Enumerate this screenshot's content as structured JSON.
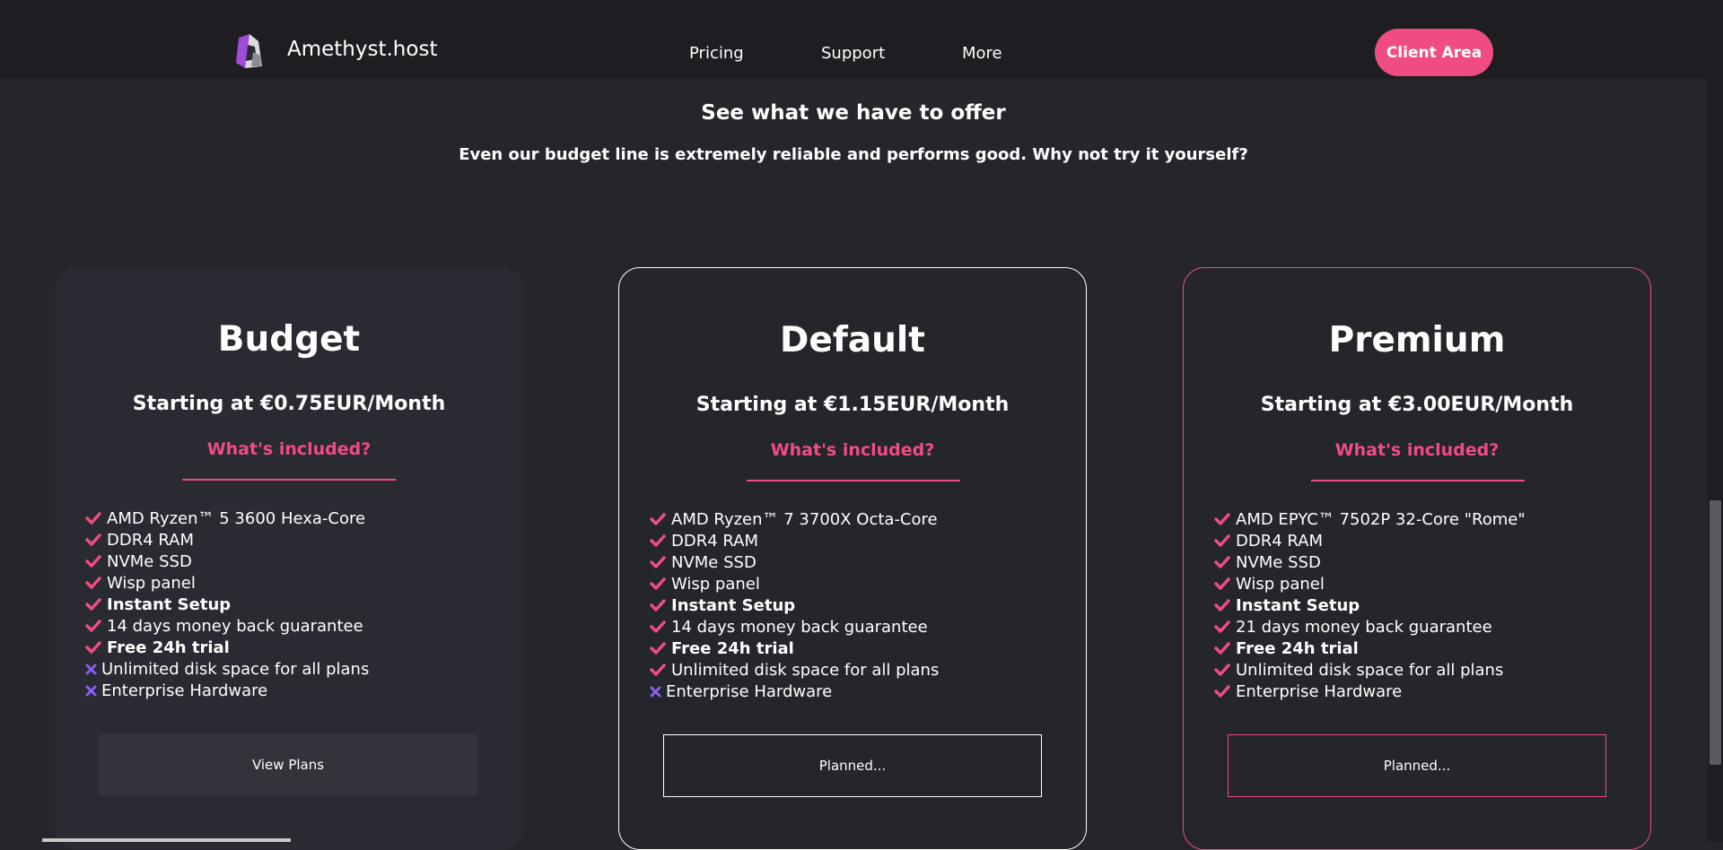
{
  "header": {
    "brand": "Amethyst.host",
    "nav": [
      "Pricing",
      "Support",
      "More"
    ],
    "client_area": "Client Area"
  },
  "section": {
    "title": "See what we have to offer",
    "subtitle": "Even our budget line is extremely reliable and performs good. Why not try it yourself?"
  },
  "colors": {
    "accent": "#ef4d81",
    "check": "#ef4d81",
    "cross": "#8b5cf6",
    "background": "#25252c",
    "navbar": "#1d1d22"
  },
  "plans": [
    {
      "title": "Budget",
      "price": "Starting at €0.75EUR/Month",
      "included_label": "What's included?",
      "button": "View Plans",
      "features": [
        {
          "text": "AMD Ryzen™ 5 3600 Hexa-Core",
          "included": true,
          "bold": false
        },
        {
          "text": "DDR4 RAM",
          "included": true,
          "bold": false
        },
        {
          "text": "NVMe SSD",
          "included": true,
          "bold": false
        },
        {
          "text": "Wisp panel",
          "included": true,
          "bold": false
        },
        {
          "text": "Instant Setup",
          "included": true,
          "bold": true
        },
        {
          "text": "14 days money back guarantee",
          "included": true,
          "bold": false
        },
        {
          "text": "Free 24h trial",
          "included": true,
          "bold": true
        },
        {
          "text": "Unlimited disk space for all plans",
          "included": false,
          "bold": false
        },
        {
          "text": "Enterprise Hardware",
          "included": false,
          "bold": false
        }
      ]
    },
    {
      "title": "Default",
      "price": "Starting at €1.15EUR/Month",
      "included_label": "What's included?",
      "button": "Planned...",
      "features": [
        {
          "text": "AMD Ryzen™ 7 3700X Octa-Core",
          "included": true,
          "bold": false
        },
        {
          "text": "DDR4 RAM",
          "included": true,
          "bold": false
        },
        {
          "text": "NVMe SSD",
          "included": true,
          "bold": false
        },
        {
          "text": "Wisp panel",
          "included": true,
          "bold": false
        },
        {
          "text": "Instant Setup",
          "included": true,
          "bold": true
        },
        {
          "text": "14 days money back guarantee",
          "included": true,
          "bold": false
        },
        {
          "text": "Free 24h trial",
          "included": true,
          "bold": true
        },
        {
          "text": "Unlimited disk space for all plans",
          "included": true,
          "bold": false
        },
        {
          "text": "Enterprise Hardware",
          "included": false,
          "bold": false
        }
      ]
    },
    {
      "title": "Premium",
      "price": "Starting at €3.00EUR/Month",
      "included_label": "What's included?",
      "button": "Planned...",
      "features": [
        {
          "text": "AMD EPYC™ 7502P 32-Core \"Rome\"",
          "included": true,
          "bold": false
        },
        {
          "text": "DDR4 RAM",
          "included": true,
          "bold": false
        },
        {
          "text": "NVMe SSD",
          "included": true,
          "bold": false
        },
        {
          "text": "Wisp panel",
          "included": true,
          "bold": false
        },
        {
          "text": "Instant Setup",
          "included": true,
          "bold": true
        },
        {
          "text": "21 days money back guarantee",
          "included": true,
          "bold": false
        },
        {
          "text": "Free 24h trial",
          "included": true,
          "bold": true
        },
        {
          "text": "Unlimited disk space for all plans",
          "included": true,
          "bold": false
        },
        {
          "text": "Enterprise Hardware",
          "included": true,
          "bold": false
        }
      ]
    }
  ]
}
